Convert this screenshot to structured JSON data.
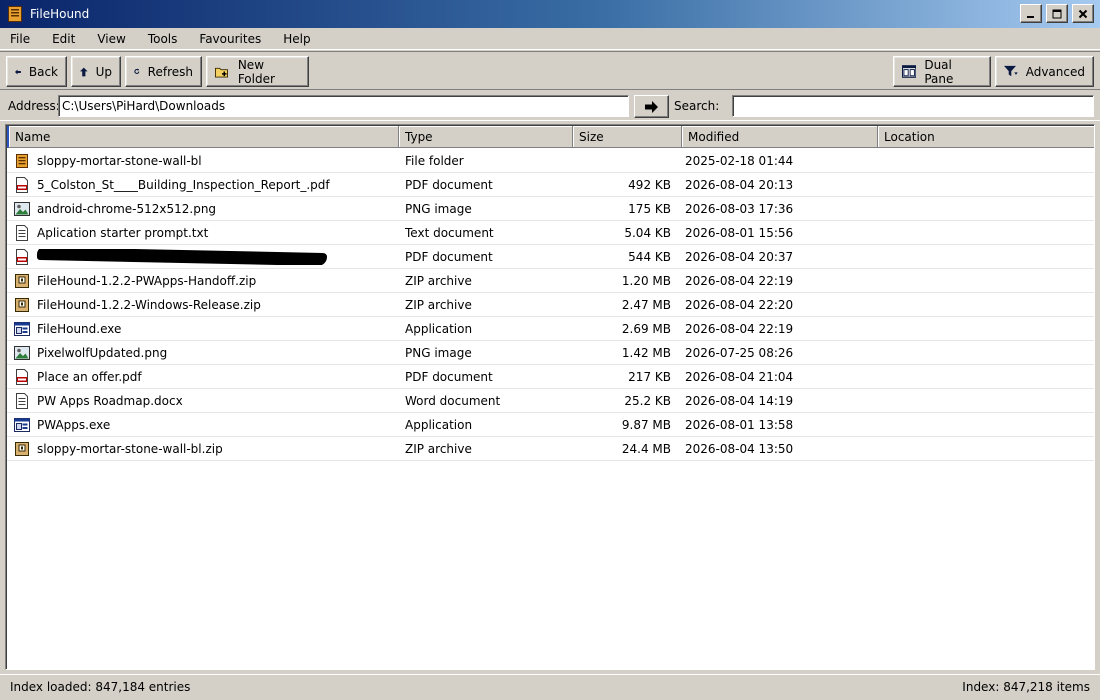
{
  "window": {
    "title": "FileHound"
  },
  "menu": [
    "File",
    "Edit",
    "View",
    "Tools",
    "Favourites",
    "Help"
  ],
  "toolbar": {
    "back": "Back",
    "up": "Up",
    "refresh": "Refresh",
    "new_folder": "New Folder",
    "dual_pane": "Dual Pane",
    "advanced": "Advanced"
  },
  "address": {
    "label": "Address:",
    "value": "C:\\Users\\PiHard\\Downloads",
    "search_label": "Search:",
    "search_value": ""
  },
  "columns": {
    "name": "Name",
    "type": "Type",
    "size": "Size",
    "modified": "Modified",
    "location": "Location"
  },
  "files": [
    {
      "name": "sloppy-mortar-stone-wall-bl",
      "type": "File folder",
      "size": "",
      "modified": "2025-02-18 01:44",
      "icon": "folder-icon"
    },
    {
      "name": "5_Colston_St____Building_Inspection_Report_.pdf",
      "type": "PDF document",
      "size": "492 KB",
      "modified": "2026-08-04 20:13",
      "icon": "pdf-icon"
    },
    {
      "name": "android-chrome-512x512.png",
      "type": "PNG image",
      "size": "175 KB",
      "modified": "2026-08-03 17:36",
      "icon": "image-icon"
    },
    {
      "name": "Aplication starter prompt.txt",
      "type": "Text document",
      "size": "5.04 KB",
      "modified": "2026-08-01 15:56",
      "icon": "text-icon"
    },
    {
      "name": "",
      "type": "PDF document",
      "size": "544 KB",
      "modified": "2026-08-04 20:37",
      "icon": "pdf-icon",
      "redacted": true
    },
    {
      "name": "FileHound-1.2.2-PWApps-Handoff.zip",
      "type": "ZIP archive",
      "size": "1.20 MB",
      "modified": "2026-08-04 22:19",
      "icon": "zip-icon"
    },
    {
      "name": "FileHound-1.2.2-Windows-Release.zip",
      "type": "ZIP archive",
      "size": "2.47 MB",
      "modified": "2026-08-04 22:20",
      "icon": "zip-icon"
    },
    {
      "name": "FileHound.exe",
      "type": "Application",
      "size": "2.69 MB",
      "modified": "2026-08-04 22:19",
      "icon": "exe-icon"
    },
    {
      "name": "PixelwolfUpdated.png",
      "type": "PNG image",
      "size": "1.42 MB",
      "modified": "2026-07-25 08:26",
      "icon": "image-icon"
    },
    {
      "name": "Place an offer.pdf",
      "type": "PDF document",
      "size": "217 KB",
      "modified": "2026-08-04 21:04",
      "icon": "pdf-icon"
    },
    {
      "name": "PW Apps Roadmap.docx",
      "type": "Word document",
      "size": "25.2 KB",
      "modified": "2026-08-04 14:19",
      "icon": "text-icon"
    },
    {
      "name": "PWApps.exe",
      "type": "Application",
      "size": "9.87 MB",
      "modified": "2026-08-01 13:58",
      "icon": "exe-icon"
    },
    {
      "name": "sloppy-mortar-stone-wall-bl.zip",
      "type": "ZIP archive",
      "size": "24.4 MB",
      "modified": "2026-08-04 13:50",
      "icon": "zip-icon"
    }
  ],
  "status": {
    "left": "Index loaded: 847,184 entries",
    "right": "Index: 847,218 items"
  }
}
